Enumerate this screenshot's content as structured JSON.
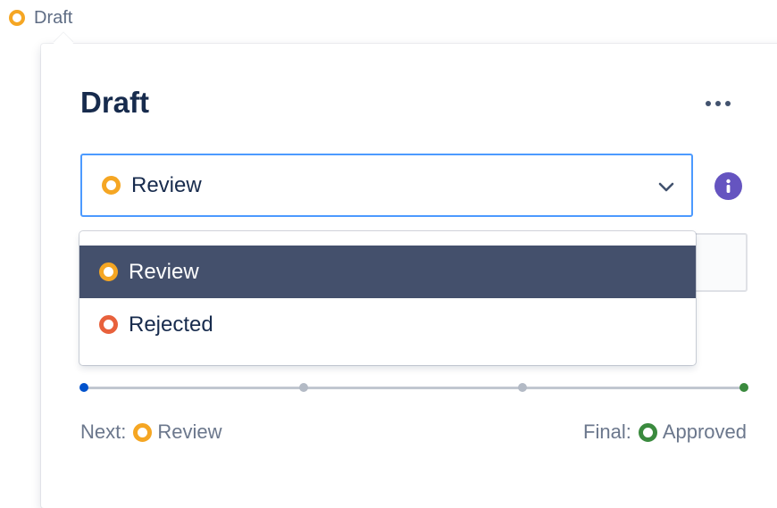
{
  "trigger": {
    "status_label": "Draft",
    "status_color": "#f5a623"
  },
  "panel": {
    "title": "Draft",
    "more_icon": "more-horizontal-icon",
    "info_icon": "info-icon"
  },
  "select": {
    "value": "Review",
    "value_color": "#f5a623",
    "chevron_icon": "chevron-down-icon",
    "focus_border_color": "#4c9aff"
  },
  "menu": {
    "options": [
      {
        "label": "Review",
        "color": "#f5a623",
        "selected": true
      },
      {
        "label": "Rejected",
        "color": "#e8613c",
        "selected": false
      }
    ],
    "selected_bg": "#44506c"
  },
  "progress": {
    "steps": 4,
    "current_step": 1,
    "start_color": "#0052cc",
    "end_color": "#3a8a3e"
  },
  "footer": {
    "next_prefix": "Next:",
    "next_status": "Review",
    "next_color": "#f5a623",
    "final_prefix": "Final:",
    "final_status": "Approved",
    "final_color": "#3a8a3e"
  }
}
